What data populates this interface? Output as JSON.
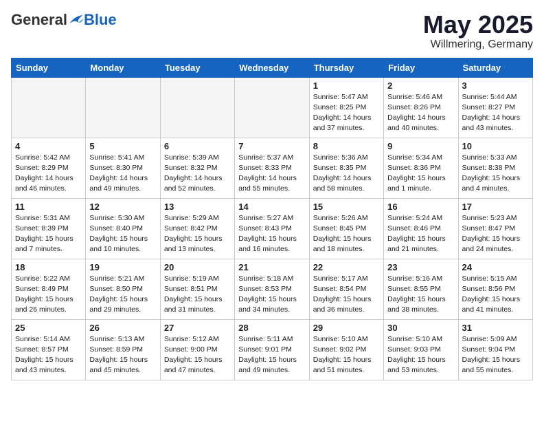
{
  "header": {
    "logo_general": "General",
    "logo_blue": "Blue",
    "month_year": "May 2025",
    "location": "Willmering, Germany"
  },
  "weekdays": [
    "Sunday",
    "Monday",
    "Tuesday",
    "Wednesday",
    "Thursday",
    "Friday",
    "Saturday"
  ],
  "weeks": [
    [
      {
        "day": "",
        "info": ""
      },
      {
        "day": "",
        "info": ""
      },
      {
        "day": "",
        "info": ""
      },
      {
        "day": "",
        "info": ""
      },
      {
        "day": "1",
        "info": "Sunrise: 5:47 AM\nSunset: 8:25 PM\nDaylight: 14 hours\nand 37 minutes."
      },
      {
        "day": "2",
        "info": "Sunrise: 5:46 AM\nSunset: 8:26 PM\nDaylight: 14 hours\nand 40 minutes."
      },
      {
        "day": "3",
        "info": "Sunrise: 5:44 AM\nSunset: 8:27 PM\nDaylight: 14 hours\nand 43 minutes."
      }
    ],
    [
      {
        "day": "4",
        "info": "Sunrise: 5:42 AM\nSunset: 8:29 PM\nDaylight: 14 hours\nand 46 minutes."
      },
      {
        "day": "5",
        "info": "Sunrise: 5:41 AM\nSunset: 8:30 PM\nDaylight: 14 hours\nand 49 minutes."
      },
      {
        "day": "6",
        "info": "Sunrise: 5:39 AM\nSunset: 8:32 PM\nDaylight: 14 hours\nand 52 minutes."
      },
      {
        "day": "7",
        "info": "Sunrise: 5:37 AM\nSunset: 8:33 PM\nDaylight: 14 hours\nand 55 minutes."
      },
      {
        "day": "8",
        "info": "Sunrise: 5:36 AM\nSunset: 8:35 PM\nDaylight: 14 hours\nand 58 minutes."
      },
      {
        "day": "9",
        "info": "Sunrise: 5:34 AM\nSunset: 8:36 PM\nDaylight: 15 hours\nand 1 minute."
      },
      {
        "day": "10",
        "info": "Sunrise: 5:33 AM\nSunset: 8:38 PM\nDaylight: 15 hours\nand 4 minutes."
      }
    ],
    [
      {
        "day": "11",
        "info": "Sunrise: 5:31 AM\nSunset: 8:39 PM\nDaylight: 15 hours\nand 7 minutes."
      },
      {
        "day": "12",
        "info": "Sunrise: 5:30 AM\nSunset: 8:40 PM\nDaylight: 15 hours\nand 10 minutes."
      },
      {
        "day": "13",
        "info": "Sunrise: 5:29 AM\nSunset: 8:42 PM\nDaylight: 15 hours\nand 13 minutes."
      },
      {
        "day": "14",
        "info": "Sunrise: 5:27 AM\nSunset: 8:43 PM\nDaylight: 15 hours\nand 16 minutes."
      },
      {
        "day": "15",
        "info": "Sunrise: 5:26 AM\nSunset: 8:45 PM\nDaylight: 15 hours\nand 18 minutes."
      },
      {
        "day": "16",
        "info": "Sunrise: 5:24 AM\nSunset: 8:46 PM\nDaylight: 15 hours\nand 21 minutes."
      },
      {
        "day": "17",
        "info": "Sunrise: 5:23 AM\nSunset: 8:47 PM\nDaylight: 15 hours\nand 24 minutes."
      }
    ],
    [
      {
        "day": "18",
        "info": "Sunrise: 5:22 AM\nSunset: 8:49 PM\nDaylight: 15 hours\nand 26 minutes."
      },
      {
        "day": "19",
        "info": "Sunrise: 5:21 AM\nSunset: 8:50 PM\nDaylight: 15 hours\nand 29 minutes."
      },
      {
        "day": "20",
        "info": "Sunrise: 5:19 AM\nSunset: 8:51 PM\nDaylight: 15 hours\nand 31 minutes."
      },
      {
        "day": "21",
        "info": "Sunrise: 5:18 AM\nSunset: 8:53 PM\nDaylight: 15 hours\nand 34 minutes."
      },
      {
        "day": "22",
        "info": "Sunrise: 5:17 AM\nSunset: 8:54 PM\nDaylight: 15 hours\nand 36 minutes."
      },
      {
        "day": "23",
        "info": "Sunrise: 5:16 AM\nSunset: 8:55 PM\nDaylight: 15 hours\nand 38 minutes."
      },
      {
        "day": "24",
        "info": "Sunrise: 5:15 AM\nSunset: 8:56 PM\nDaylight: 15 hours\nand 41 minutes."
      }
    ],
    [
      {
        "day": "25",
        "info": "Sunrise: 5:14 AM\nSunset: 8:57 PM\nDaylight: 15 hours\nand 43 minutes."
      },
      {
        "day": "26",
        "info": "Sunrise: 5:13 AM\nSunset: 8:59 PM\nDaylight: 15 hours\nand 45 minutes."
      },
      {
        "day": "27",
        "info": "Sunrise: 5:12 AM\nSunset: 9:00 PM\nDaylight: 15 hours\nand 47 minutes."
      },
      {
        "day": "28",
        "info": "Sunrise: 5:11 AM\nSunset: 9:01 PM\nDaylight: 15 hours\nand 49 minutes."
      },
      {
        "day": "29",
        "info": "Sunrise: 5:10 AM\nSunset: 9:02 PM\nDaylight: 15 hours\nand 51 minutes."
      },
      {
        "day": "30",
        "info": "Sunrise: 5:10 AM\nSunset: 9:03 PM\nDaylight: 15 hours\nand 53 minutes."
      },
      {
        "day": "31",
        "info": "Sunrise: 5:09 AM\nSunset: 9:04 PM\nDaylight: 15 hours\nand 55 minutes."
      }
    ]
  ]
}
